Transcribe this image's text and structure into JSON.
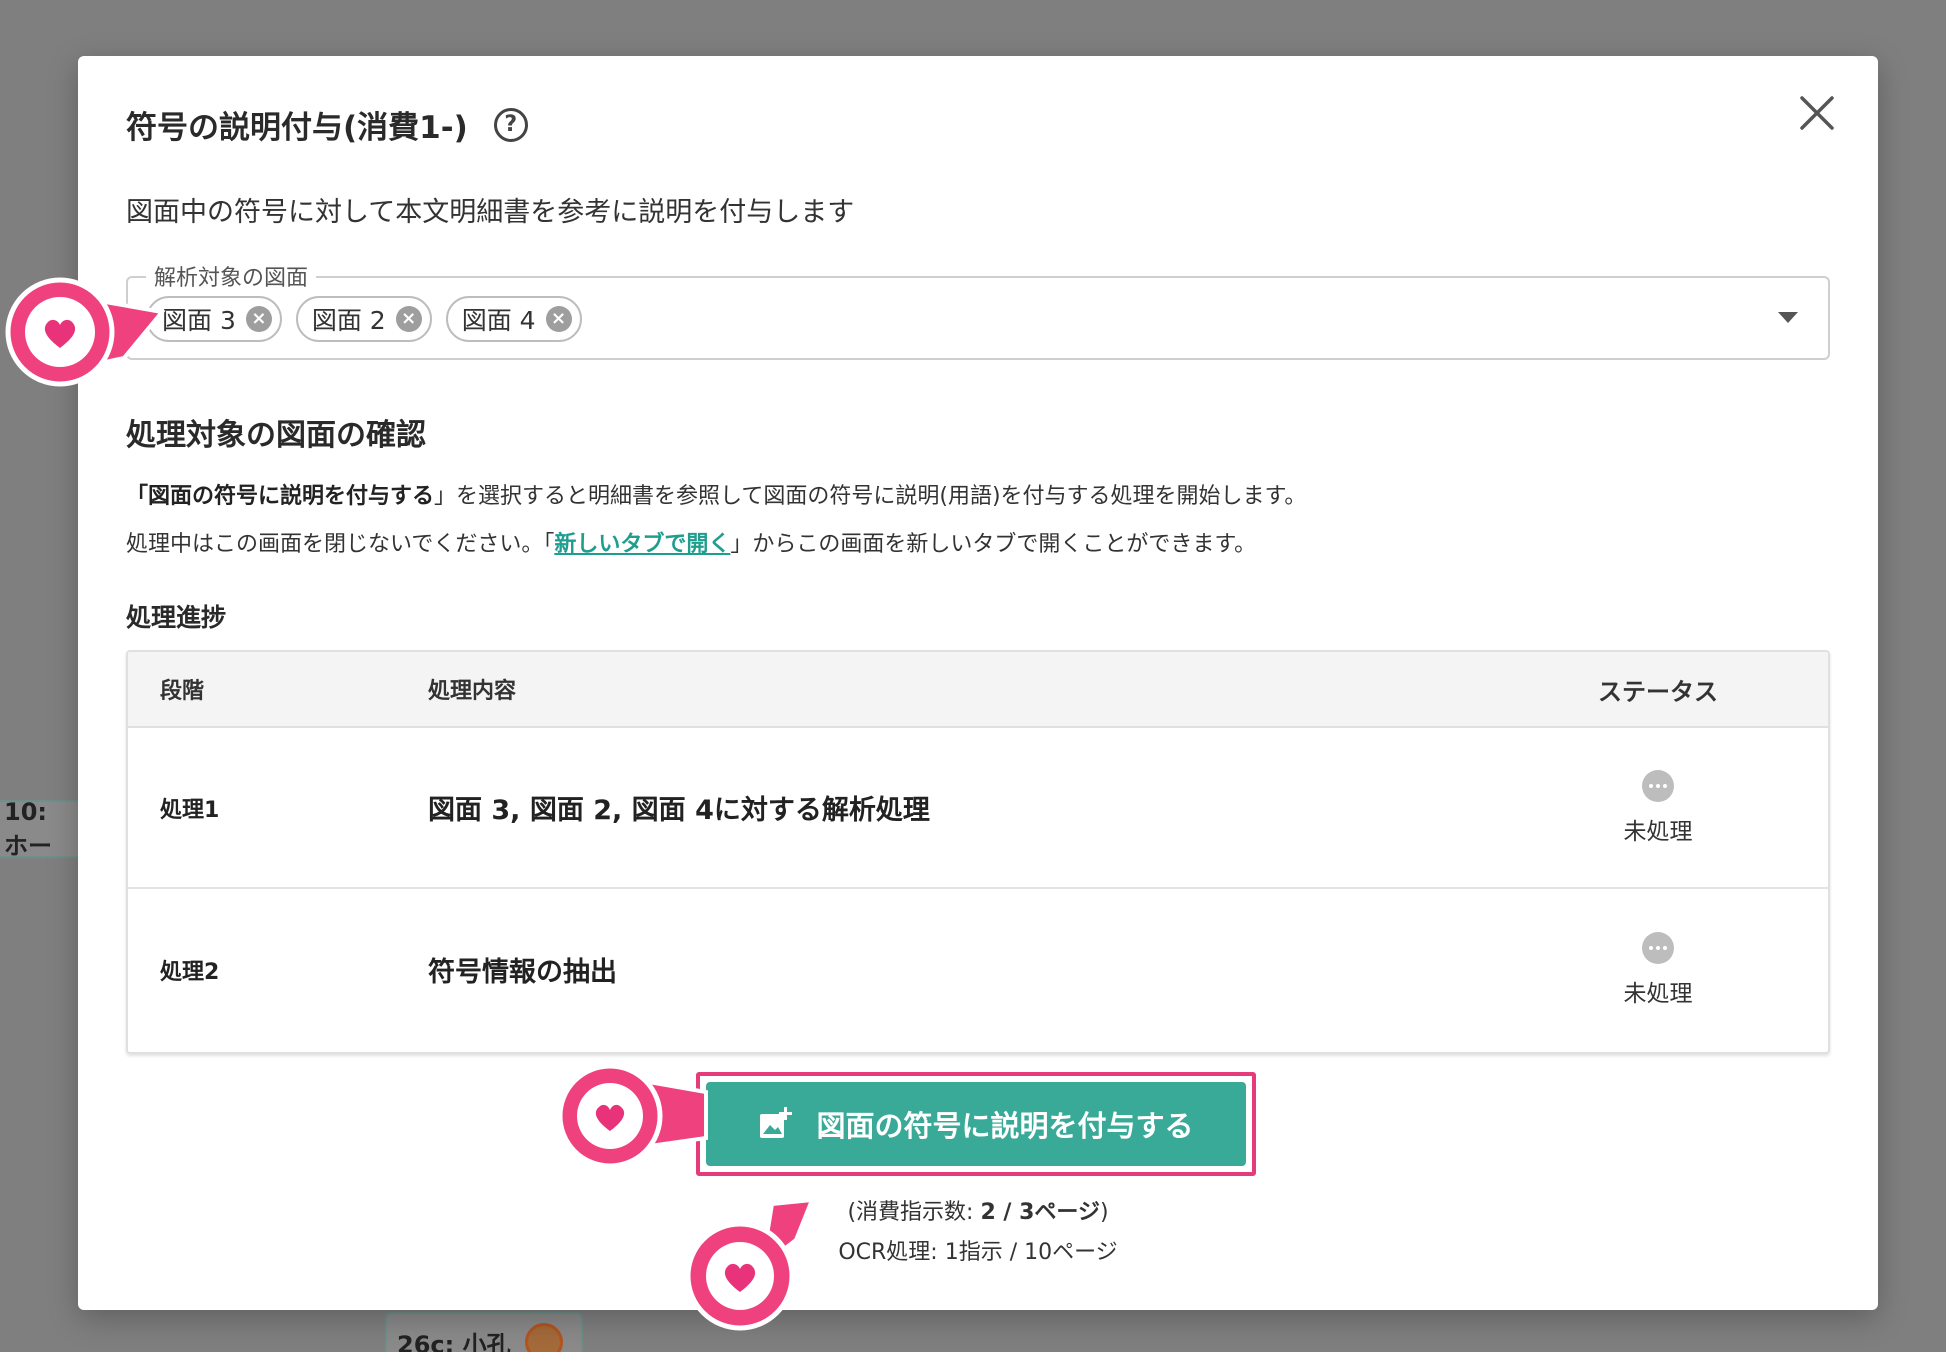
{
  "background": {
    "left_node_label": "10: ホー",
    "bottom_node_label": "26c: 小孔"
  },
  "modal": {
    "title": "符号の説明付与(消費1-)",
    "description": "図面中の符号に対して本文明細書を参考に説明を付与します",
    "select": {
      "legend": "解析対象の図面",
      "chips": [
        "図面 3",
        "図面 2",
        "図面 4"
      ]
    },
    "confirm": {
      "title": "処理対象の図面の確認",
      "p1_quote_open": "「",
      "p1_bold": "図面の符号に説明を付与する",
      "p1_rest": "」を選択すると明細書を参照して図面の符号に説明(用語)を付与する処理を開始します。",
      "p2_before": "処理中はこの画面を閉じないでください。「",
      "p2_link": "新しいタブで開く",
      "p2_after": "」からこの画面を新しいタブで開くことができます。"
    },
    "progress": {
      "title": "処理進捗",
      "headers": {
        "step": "段階",
        "content": "処理内容",
        "status": "ステータス"
      },
      "rows": [
        {
          "step": "処理1",
          "content": "図面 3, 図面 2, 図面 4に対する解析処理",
          "status": "未処理"
        },
        {
          "step": "処理2",
          "content": "符号情報の抽出",
          "status": "未処理"
        }
      ]
    },
    "action_button": "図面の符号に説明を付与する",
    "consumption": {
      "l1_prefix": "(消費指示数: ",
      "l1_bold": "2 / 3ページ",
      "l1_suffix": ")",
      "l2": "OCR処理: 1指示 / 10ページ"
    }
  },
  "colors": {
    "accent": "#3aaa98",
    "highlight": "#e63b7a",
    "link": "#1f9e8f",
    "overlay": "#7f7f7f"
  }
}
